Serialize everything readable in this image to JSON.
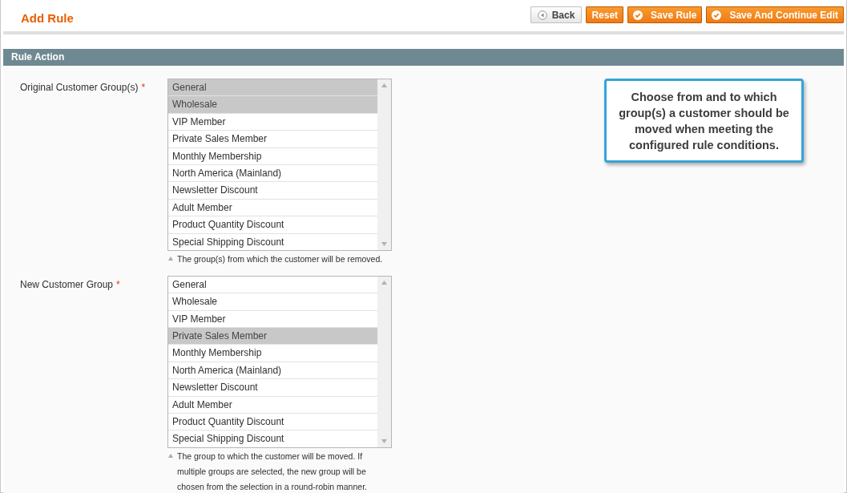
{
  "page_title": "Add Rule",
  "buttons": [
    {
      "label": "Back",
      "kind": "back"
    },
    {
      "label": "Reset",
      "kind": "plain"
    },
    {
      "label": "Save Rule",
      "kind": "save"
    },
    {
      "label": "Save And Continue Edit",
      "kind": "save"
    }
  ],
  "section": {
    "title": "Rule Action"
  },
  "fields": [
    {
      "label": "Original Customer Group(s)",
      "required_mark": "*",
      "note": "The group(s) from which the customer will be removed.",
      "options": [
        {
          "label": "General",
          "selected": true
        },
        {
          "label": "Wholesale",
          "selected": true
        },
        {
          "label": "VIP Member",
          "selected": false
        },
        {
          "label": "Private Sales Member",
          "selected": false
        },
        {
          "label": "Monthly Membership",
          "selected": false
        },
        {
          "label": "North America (Mainland)",
          "selected": false
        },
        {
          "label": "Newsletter Discount",
          "selected": false
        },
        {
          "label": "Adult Member",
          "selected": false
        },
        {
          "label": "Product Quantity Discount",
          "selected": false
        },
        {
          "label": "Special Shipping Discount",
          "selected": false
        }
      ]
    },
    {
      "label": "New Customer Group",
      "required_mark": "*",
      "note": "The group to which the customer will be moved. If multiple groups are selected, the new group will be chosen from the selection in a round-robin manner.",
      "options": [
        {
          "label": "General",
          "selected": false
        },
        {
          "label": "Wholesale",
          "selected": false
        },
        {
          "label": "VIP Member",
          "selected": false
        },
        {
          "label": "Private Sales Member",
          "selected": true
        },
        {
          "label": "Monthly Membership",
          "selected": false
        },
        {
          "label": "North America (Mainland)",
          "selected": false
        },
        {
          "label": "Newsletter Discount",
          "selected": false
        },
        {
          "label": "Adult Member",
          "selected": false
        },
        {
          "label": "Product Quantity Discount",
          "selected": false
        },
        {
          "label": "Special Shipping Discount",
          "selected": false
        }
      ]
    }
  ],
  "callout": {
    "text": "Choose from and to which group(s) a customer should be moved when meeting the configured rule conditions."
  }
}
